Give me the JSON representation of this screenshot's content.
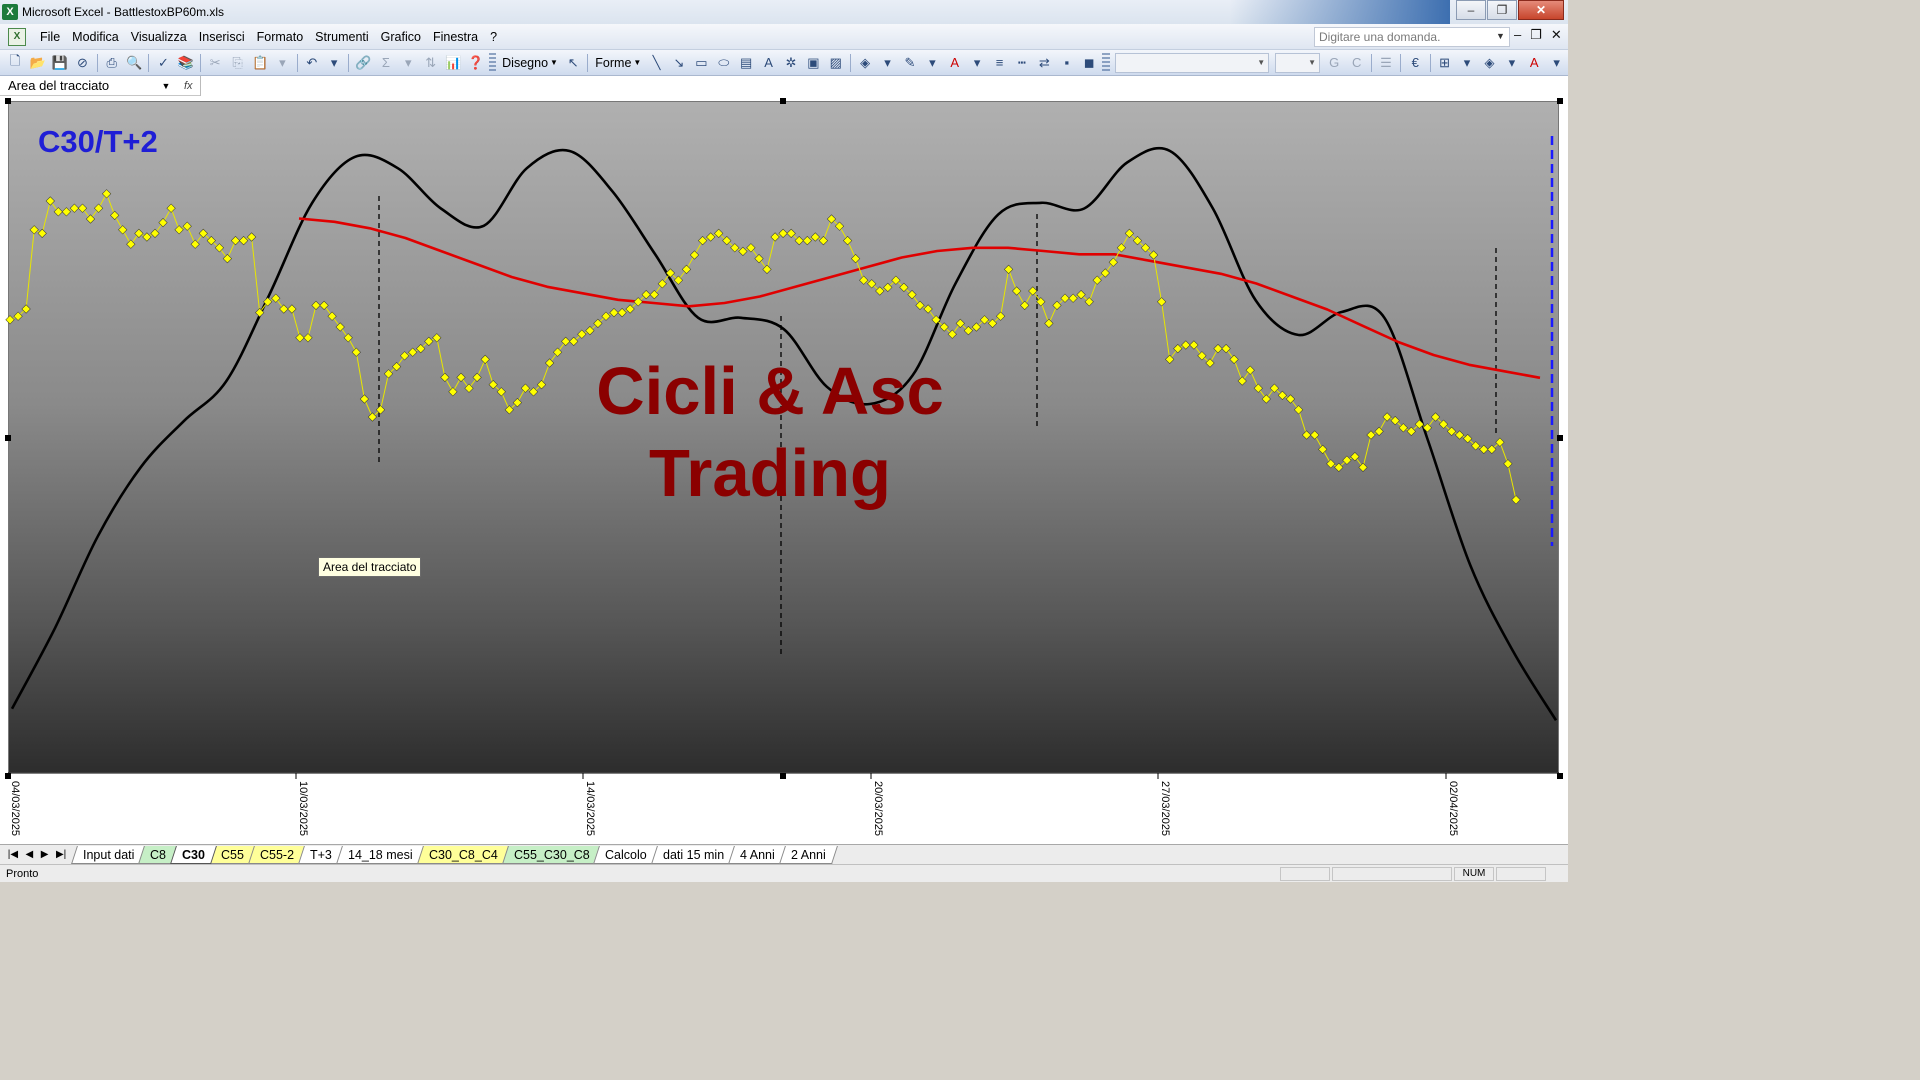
{
  "window": {
    "title": "Microsoft Excel - BattlestoxBP60m.xls",
    "app_icon": "excel-icon",
    "buttons": {
      "minimize": "‒",
      "maximize": "❐",
      "close": "✕"
    }
  },
  "menu": {
    "items": [
      {
        "label": "File"
      },
      {
        "label": "Modifica"
      },
      {
        "label": "Visualizza"
      },
      {
        "label": "Inserisci"
      },
      {
        "label": "Formato"
      },
      {
        "label": "Strumenti"
      },
      {
        "label": "Grafico"
      },
      {
        "label": "Finestra"
      },
      {
        "label": "?"
      }
    ],
    "ask_placeholder": "Digitare una domanda."
  },
  "toolbar": {
    "disegno_label": "Disegno",
    "forme_label": "Forme"
  },
  "namebar": {
    "name_box": "Area del tracciato",
    "fx": "fx"
  },
  "chart": {
    "title": "C30/T+2",
    "watermark_line1": "Cicli & Asc",
    "watermark_line2": "Trading",
    "tooltip": "Area del tracciato",
    "colors": {
      "price": "#ffff00",
      "price_line": "#e8e600",
      "average": "#e00000",
      "cycle": "#000000",
      "title": "#1f1ed6",
      "watermark": "#8b0000",
      "marker_line": "#1a1aff"
    }
  },
  "chart_data": {
    "type": "line",
    "x_tick_labels": [
      "04/03/2025",
      "10/03/2025",
      "14/03/2025",
      "20/03/2025",
      "27/03/2025",
      "02/04/2025"
    ],
    "series": [
      {
        "values": [
          0.67,
          0.68,
          0.7,
          0.92,
          0.91,
          1.0,
          0.97,
          0.97,
          0.98,
          0.98,
          0.95,
          0.98,
          1.02,
          0.96,
          0.92,
          0.88,
          0.91,
          0.9,
          0.91,
          0.94,
          0.98,
          0.92,
          0.93,
          0.88,
          0.91,
          0.89,
          0.87,
          0.84,
          0.89,
          0.89,
          0.9,
          0.69,
          0.72,
          0.73,
          0.7,
          0.7,
          0.62,
          0.62,
          0.71,
          0.71,
          0.68,
          0.65,
          0.62,
          0.58,
          0.45,
          0.4,
          0.42,
          0.52,
          0.54,
          0.57,
          0.58,
          0.59,
          0.61,
          0.62,
          0.51,
          0.47,
          0.51,
          0.48,
          0.51,
          0.56,
          0.49,
          0.47,
          0.42,
          0.44,
          0.48,
          0.47,
          0.49,
          0.55,
          0.58,
          0.61,
          0.61,
          0.63,
          0.64,
          0.66,
          0.68,
          0.69,
          0.69,
          0.7,
          0.72,
          0.74,
          0.74,
          0.77,
          0.8,
          0.78,
          0.81,
          0.85,
          0.89,
          0.9,
          0.91,
          0.89,
          0.87,
          0.86,
          0.87,
          0.84,
          0.81,
          0.9,
          0.91,
          0.91,
          0.89,
          0.89,
          0.9,
          0.89,
          0.95,
          0.93,
          0.89,
          0.84,
          0.78,
          0.77,
          0.75,
          0.76,
          0.78,
          0.76,
          0.74,
          0.71,
          0.7,
          0.67,
          0.65,
          0.63,
          0.66,
          0.64,
          0.65,
          0.67,
          0.66,
          0.68,
          0.81,
          0.75,
          0.71,
          0.75,
          0.72,
          0.66,
          0.71,
          0.73,
          0.73,
          0.74,
          0.72,
          0.78,
          0.8,
          0.83,
          0.87,
          0.91,
          0.89,
          0.87,
          0.85,
          0.72,
          0.56,
          0.59,
          0.6,
          0.6,
          0.57,
          0.55,
          0.59,
          0.59,
          0.56,
          0.5,
          0.53,
          0.48,
          0.45,
          0.48,
          0.46,
          0.45,
          0.42,
          0.35,
          0.35,
          0.31,
          0.27,
          0.26,
          0.28,
          0.29,
          0.26,
          0.35,
          0.36,
          0.4,
          0.39,
          0.37,
          0.36,
          0.38,
          0.37,
          0.4,
          0.38,
          0.36,
          0.35,
          0.34,
          0.32,
          0.31,
          0.31,
          0.33,
          0.27,
          0.17
        ]
      },
      {
        "values": [
          0.9,
          0.89,
          0.87,
          0.84,
          0.8,
          0.76,
          0.72,
          0.69,
          0.67,
          0.65,
          0.64,
          0.63,
          0.64,
          0.66,
          0.69,
          0.72,
          0.75,
          0.78,
          0.8,
          0.81,
          0.81,
          0.8,
          0.79,
          0.79,
          0.77,
          0.75,
          0.73,
          0.7,
          0.66,
          0.62,
          0.57,
          0.52,
          0.48,
          0.45,
          0.43,
          0.41
        ]
      },
      {
        "values": [
          0.03,
          0.17,
          0.33,
          0.45,
          0.53,
          0.6,
          0.75,
          0.91,
          0.99,
          0.97,
          0.9,
          0.87,
          0.97,
          1.0,
          0.93,
          0.82,
          0.71,
          0.71,
          0.69,
          0.59,
          0.56,
          0.61,
          0.77,
          0.89,
          0.91,
          0.9,
          0.98,
          1.0,
          0.9,
          0.74,
          0.68,
          0.72,
          0.71,
          0.5,
          0.28,
          0.13,
          0.01
        ]
      }
    ]
  },
  "sheet_tabs": [
    {
      "label": "Input dati",
      "style": "plain"
    },
    {
      "label": "C8",
      "style": "green"
    },
    {
      "label": "C30",
      "style": "active"
    },
    {
      "label": "C55",
      "style": "yellow"
    },
    {
      "label": "C55-2",
      "style": "yellow"
    },
    {
      "label": "T+3",
      "style": "plain"
    },
    {
      "label": "14_18 mesi",
      "style": "plain"
    },
    {
      "label": "C30_C8_C4",
      "style": "yellow"
    },
    {
      "label": "C55_C30_C8",
      "style": "green"
    },
    {
      "label": "Calcolo",
      "style": "plain"
    },
    {
      "label": "dati 15 min",
      "style": "plain"
    },
    {
      "label": "4 Anni",
      "style": "plain"
    },
    {
      "label": "2 Anni",
      "style": "plain"
    }
  ],
  "status": {
    "text": "Pronto",
    "num": "NUM"
  }
}
